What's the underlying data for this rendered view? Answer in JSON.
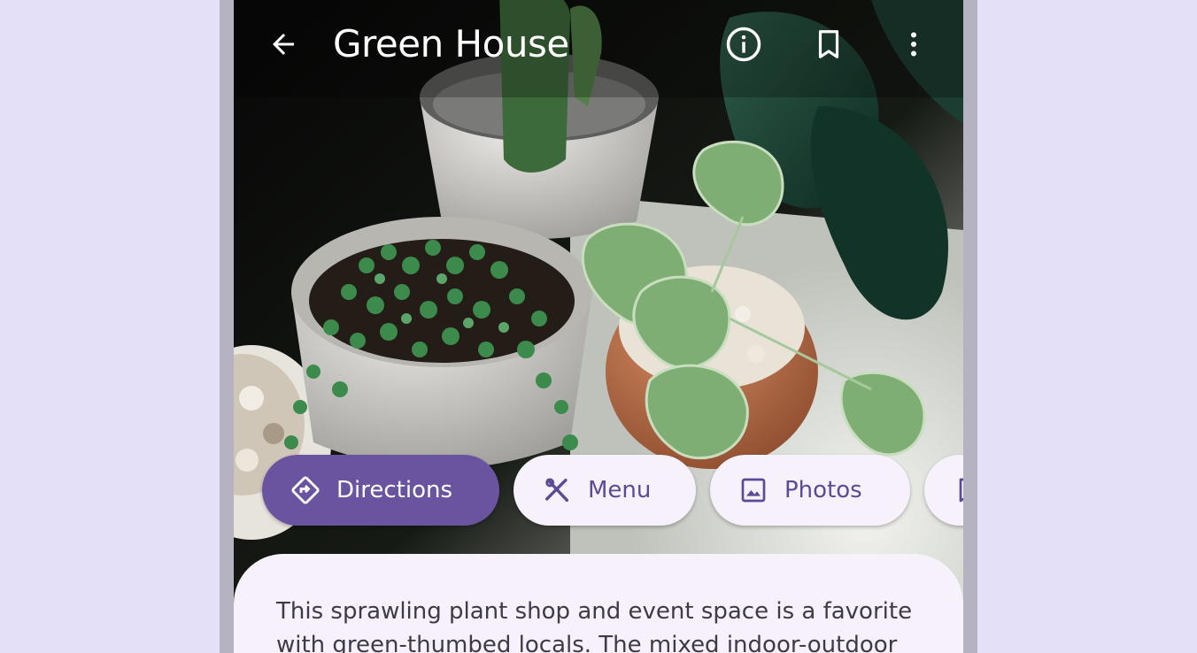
{
  "app_bar": {
    "title": "Green House",
    "back_icon": "arrow-back-icon",
    "info_icon": "info-icon",
    "bookmark_icon": "bookmark-icon",
    "more_icon": "more-vert-icon"
  },
  "chips": [
    {
      "label": "Directions",
      "icon": "directions-icon",
      "selected": true
    },
    {
      "label": "Menu",
      "icon": "restaurant-icon",
      "selected": false
    },
    {
      "label": "Photos",
      "icon": "image-icon",
      "selected": false
    },
    {
      "label": "",
      "icon": "bookmark-icon",
      "selected": false
    }
  ],
  "details": {
    "description": "This sprawling plant shop and event space is a favorite with green-thumbed locals. The mixed indoor-outdoor"
  },
  "colors": {
    "primary": "#6a54a0",
    "on_primary": "#ffffff",
    "chip_surface": "#f6f1fa",
    "chip_text": "#5d4a96",
    "sheet_surface": "#f6f1fa",
    "page_background": "#e3e0f7"
  }
}
